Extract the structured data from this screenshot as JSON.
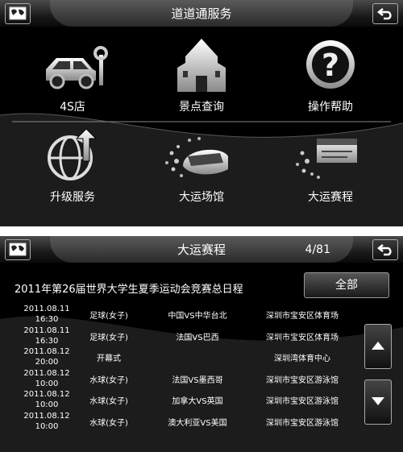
{
  "screen1": {
    "header": {
      "title": "道道通服务",
      "left_icon": "map-icon",
      "right_icon": "back-arrow-icon"
    },
    "tiles": [
      {
        "label": "4S店",
        "icon": "car-wrench-icon"
      },
      {
        "label": "景点查询",
        "icon": "castle-icon"
      },
      {
        "label": "操作帮助",
        "icon": "question-icon"
      },
      {
        "label": "升级服务",
        "icon": "globe-upgrade-icon"
      },
      {
        "label": "大运场馆",
        "icon": "stadium-icon"
      },
      {
        "label": "大运赛程",
        "icon": "schedule-icon"
      }
    ]
  },
  "screen2": {
    "header": {
      "title": "大运赛程",
      "page": "4/81",
      "left_icon": "map-icon",
      "right_icon": "back-arrow-icon"
    },
    "schedule_title": "2011年第26届世界大学生夏季运动会竞赛总日程",
    "all_button": "全部",
    "rows": [
      {
        "date": "2011.08.11",
        "time": "16:30",
        "sport": "足球(女子)",
        "match": "中国VS中华台北",
        "venue": "深圳市宝安区体育场"
      },
      {
        "date": "2011.08.11",
        "time": "16:30",
        "sport": "足球(女子)",
        "match": "法国VS巴西",
        "venue": "深圳市宝安区体育场"
      },
      {
        "date": "2011.08.12",
        "time": "20:00",
        "sport": "开幕式",
        "match": "",
        "venue": "深圳湾体育中心"
      },
      {
        "date": "2011.08.12",
        "time": "10:00",
        "sport": "水球(女子)",
        "match": "法国VS墨西哥",
        "venue": "深圳市宝安区游泳馆"
      },
      {
        "date": "2011.08.12",
        "time": "10:00",
        "sport": "水球(女子)",
        "match": "加拿大VS英国",
        "venue": "深圳市宝安区游泳馆"
      },
      {
        "date": "2011.08.12",
        "time": "10:00",
        "sport": "水球(女子)",
        "match": "澳大利亚VS美国",
        "venue": "深圳市宝安区游泳馆"
      }
    ],
    "scroll": {
      "up_icon": "triangle-up-icon",
      "down_icon": "triangle-down-icon"
    }
  },
  "colors": {
    "background": "#000000",
    "text": "#ffffff",
    "icon_silver": "#d9d9d9"
  }
}
